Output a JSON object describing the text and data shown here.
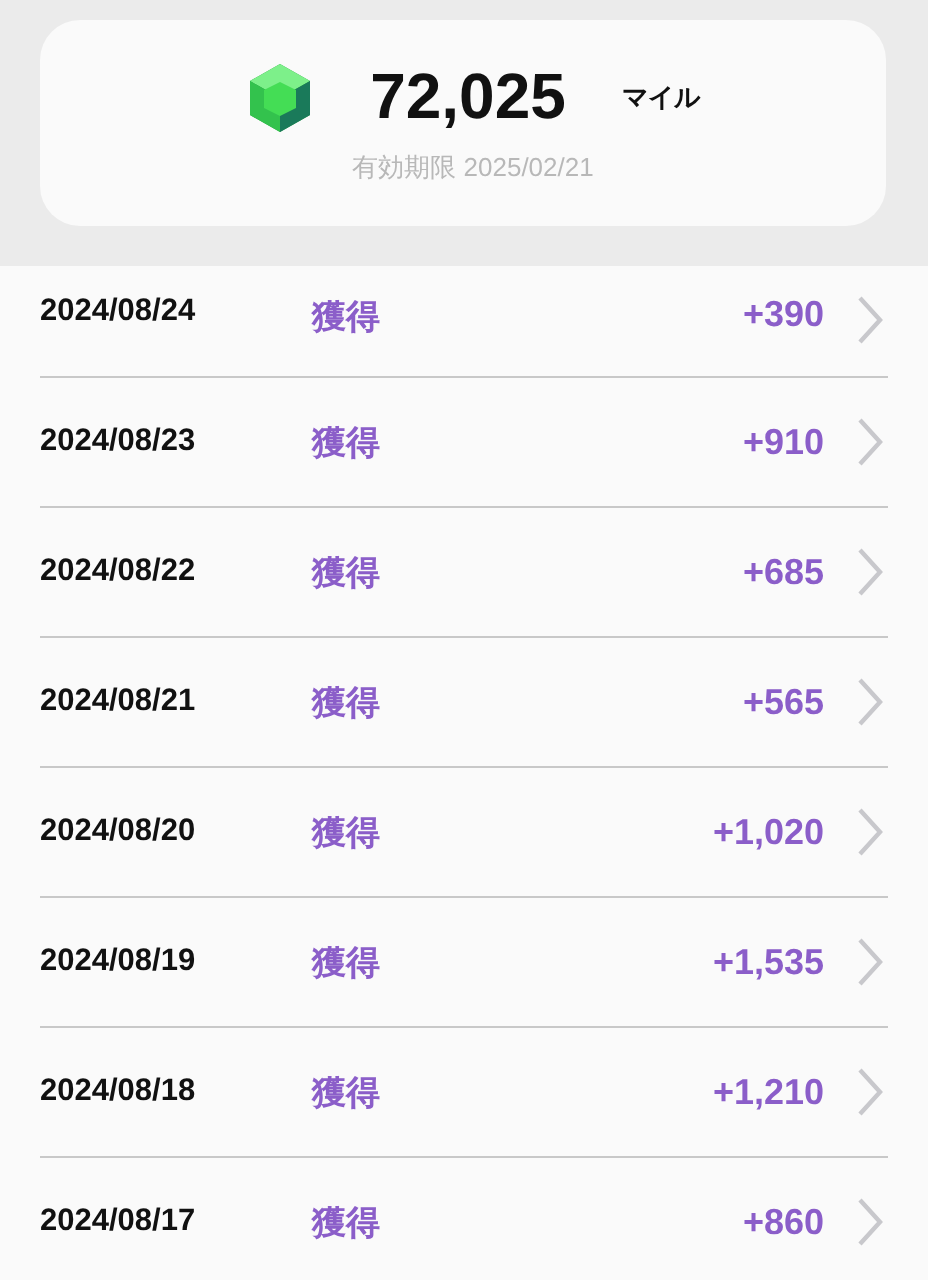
{
  "summary": {
    "balance": "72,025",
    "unit": "マイル",
    "expiry": "有効期限 2025/02/21"
  },
  "history": [
    {
      "date": "2024/08/24",
      "type": "獲得",
      "amount": "+390"
    },
    {
      "date": "2024/08/23",
      "type": "獲得",
      "amount": "+910"
    },
    {
      "date": "2024/08/22",
      "type": "獲得",
      "amount": "+685"
    },
    {
      "date": "2024/08/21",
      "type": "獲得",
      "amount": "+565"
    },
    {
      "date": "2024/08/20",
      "type": "獲得",
      "amount": "+1,020"
    },
    {
      "date": "2024/08/19",
      "type": "獲得",
      "amount": "+1,535"
    },
    {
      "date": "2024/08/18",
      "type": "獲得",
      "amount": "+1,210"
    },
    {
      "date": "2024/08/17",
      "type": "獲得",
      "amount": "+860"
    }
  ]
}
